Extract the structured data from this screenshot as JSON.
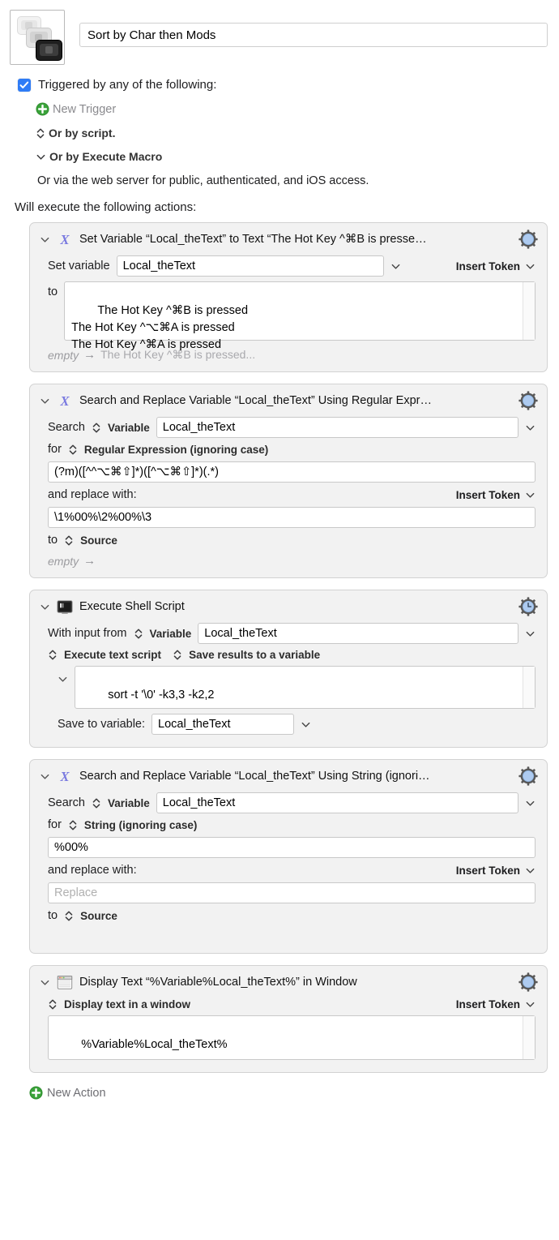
{
  "header": {
    "macro_icon": "stacked-keys-icon",
    "macro_name": "Sort by Char then Mods"
  },
  "triggers": {
    "checkbox_checked": true,
    "label": "Triggered by any of the following:",
    "new_trigger_label": "New Trigger",
    "or_by_script": "Or by script.",
    "or_by_execute_macro": "Or by Execute Macro",
    "web_server_note": "Or via the web server for public, authenticated, and iOS access."
  },
  "will_execute_label": "Will execute the following actions:",
  "new_action_label": "New Action",
  "colors": {
    "accent_blue": "#2f7cf6",
    "green_plus": "#3aa33a",
    "variable_icon_purple": "#7a7ae0",
    "gear_blue": "#aecbf0",
    "panel_bg": "#f2f2f2",
    "panel_border": "#d2d2d2"
  },
  "actions": [
    {
      "icon": "variable-x-icon",
      "gear": "gear-icon",
      "title": "Set Variable “Local_theText” to Text “The Hot Key ^⌘B is presse…",
      "set_variable_label": "Set variable",
      "variable_value": "Local_theText",
      "insert_token_label": "Insert Token",
      "to_label": "to",
      "text_value": "The Hot Key ^⌘B is pressed\nThe Hot Key ^⌥⌘A is pressed\nThe Hot Key ^⌘A is pressed",
      "hint_empty": "empty",
      "hint_arrow": "→",
      "hint_result": "The Hot Key ^⌘B is pressed..."
    },
    {
      "icon": "variable-x-icon",
      "gear": "gear-icon",
      "title": "Search and Replace Variable “Local_theText” Using Regular Expr…",
      "search_label": "Search",
      "search_source": "Variable",
      "variable_value": "Local_theText",
      "for_label": "for",
      "match_mode": "Regular Expression (ignoring case)",
      "search_pattern": "(?m)([^^⌥⌘⇧]*)([^⌥⌘⇧]*)(.*)",
      "replace_label": "and replace with:",
      "insert_token_label": "Insert Token",
      "replace_value": "\\1%00%\\2%00%\\3",
      "to_label": "to",
      "to_target": "Source",
      "hint_empty": "empty",
      "hint_arrow": "→"
    },
    {
      "icon": "terminal-icon",
      "gear": "gear-clock-icon",
      "title": "Execute Shell Script",
      "input_label": "With input from",
      "input_source": "Variable",
      "variable_value": "Local_theText",
      "script_mode": "Execute text script",
      "results_mode": "Save results to a variable",
      "script_value": "sort -t '\\0' -k3,3 -k2,2",
      "save_label": "Save to variable:",
      "save_variable": "Local_theText"
    },
    {
      "icon": "variable-x-icon",
      "gear": "gear-icon",
      "title": "Search and Replace Variable “Local_theText” Using String (ignori…",
      "search_label": "Search",
      "search_source": "Variable",
      "variable_value": "Local_theText",
      "for_label": "for",
      "match_mode": "String (ignoring case)",
      "search_pattern": "%00%",
      "replace_label": "and replace with:",
      "insert_token_label": "Insert Token",
      "replace_placeholder": "Replace",
      "to_label": "to",
      "to_target": "Source"
    },
    {
      "icon": "window-text-icon",
      "gear": "gear-icon",
      "title": "Display Text “%Variable%Local_theText%” in Window",
      "display_mode": "Display text in a window",
      "insert_token_label": "Insert Token",
      "text_value": "%Variable%Local_theText%"
    }
  ]
}
